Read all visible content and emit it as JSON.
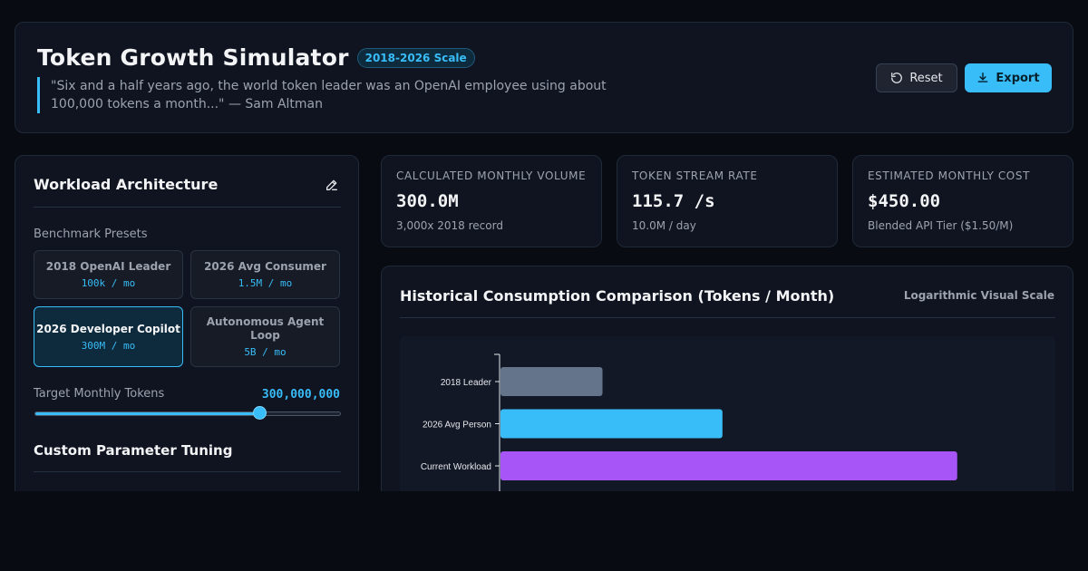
{
  "header": {
    "title": "Token Growth Simulator",
    "badge": "2018-2026 Scale",
    "quote": "\"Six and a half years ago, the world token leader was an OpenAI employee using about 100,000 tokens a month...\" — Sam Altman",
    "reset_label": "Reset",
    "export_label": "Export"
  },
  "workload": {
    "title": "Workload Architecture",
    "presets_label": "Benchmark Presets",
    "presets": [
      {
        "name": "2018 OpenAI Leader",
        "value": "100k / mo",
        "active": false
      },
      {
        "name": "2026 Avg Consumer",
        "value": "1.5M / mo",
        "active": false
      },
      {
        "name": "2026 Developer Copilot",
        "value": "300M / mo",
        "active": true
      },
      {
        "name": "Autonomous Agent Loop",
        "value": "5B / mo",
        "active": false
      }
    ],
    "target_label": "Target Monthly Tokens",
    "target_value": "300,000,000",
    "slider_fraction": 0.735,
    "custom_title": "Custom Parameter Tuning"
  },
  "stats": [
    {
      "label": "CALCULATED MONTHLY VOLUME",
      "value": "300.0M",
      "sub": "3,000x 2018 record"
    },
    {
      "label": "TOKEN STREAM RATE",
      "value": "115.7 /s",
      "sub": "10.0M / day"
    },
    {
      "label": "ESTIMATED MONTHLY COST",
      "value": "$450.00",
      "sub": "Blended API Tier ($1.50/M)"
    }
  ],
  "chart_header": {
    "title": "Historical Consumption Comparison (Tokens / Month)",
    "scale_label": "Logarithmic Visual Scale"
  },
  "chart_data": {
    "type": "bar",
    "orientation": "horizontal",
    "scale": "log",
    "categories": [
      "2018 Leader",
      "2026 Avg Person",
      "Current Workload"
    ],
    "values": [
      100000,
      1500000,
      300000000
    ],
    "colors": [
      "#64748b",
      "#38bdf8",
      "#a855f7"
    ],
    "log_min_exponent": 4
  },
  "colors": {
    "accent": "#38bdf8",
    "purple": "#a855f7",
    "slate": "#64748b",
    "background": "#080b12"
  }
}
